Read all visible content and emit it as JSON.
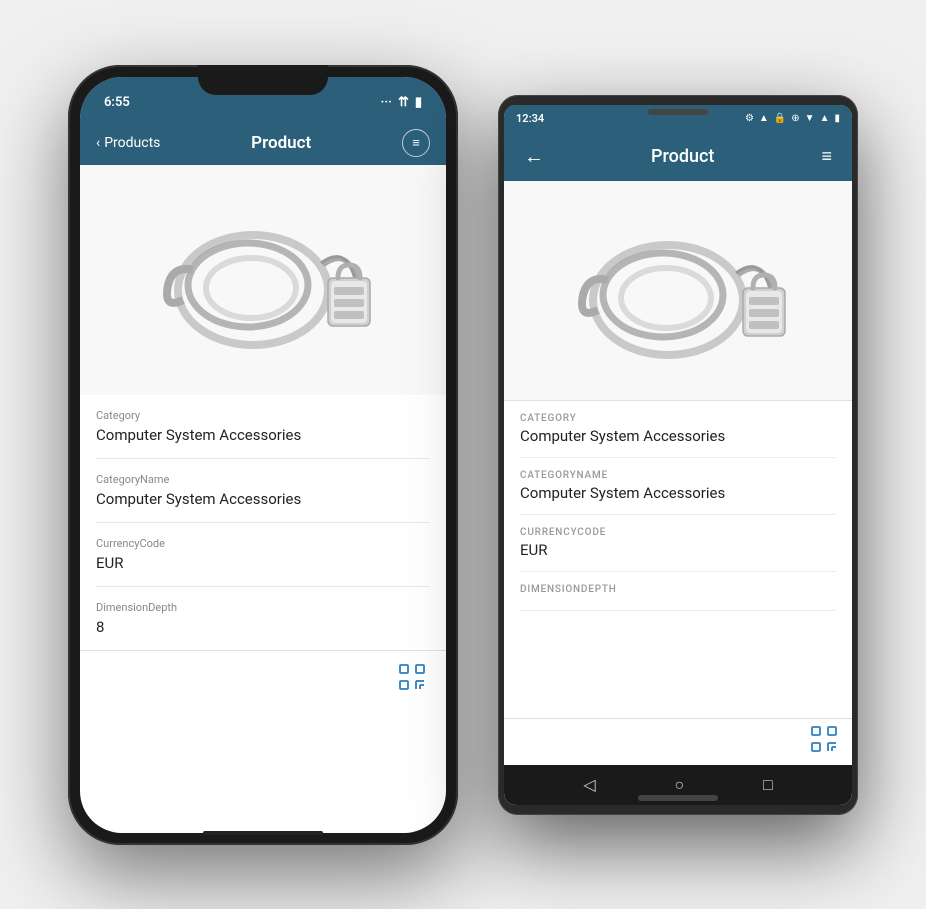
{
  "ios": {
    "status_time": "6:55",
    "nav_back_label": "Products",
    "nav_title": "Product",
    "product_fields": [
      {
        "label": "Category",
        "value": "Computer System Accessories"
      },
      {
        "label": "CategoryName",
        "value": "Computer System Accessories"
      },
      {
        "label": "CurrencyCode",
        "value": "EUR"
      },
      {
        "label": "DimensionDepth",
        "value": "8"
      }
    ]
  },
  "android": {
    "status_time": "12:34",
    "nav_title": "Product",
    "product_fields": [
      {
        "label": "CATEGORY",
        "value": "Computer System Accessories"
      },
      {
        "label": "CATEGORYNAME",
        "value": "Computer System Accessories"
      },
      {
        "label": "CURRENCYCODE",
        "value": "EUR"
      },
      {
        "label": "DIMENSIONDEPTH",
        "value": ""
      }
    ]
  },
  "colors": {
    "nav_bg": "#2c5f7a",
    "accent_blue": "#2c7fc0"
  }
}
